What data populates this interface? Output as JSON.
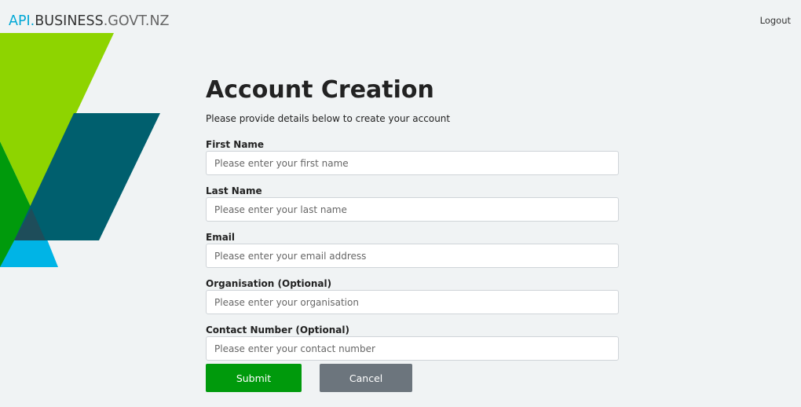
{
  "header": {
    "logo": {
      "part1": "API.",
      "part2": "BUSINESS",
      "part3": ".GOVT.NZ"
    },
    "logout_label": "Logout"
  },
  "main": {
    "title": "Account Creation",
    "subtitle": "Please provide details below to create your account",
    "fields": [
      {
        "label": "First Name",
        "placeholder": "Please enter your first name",
        "value": ""
      },
      {
        "label": "Last Name",
        "placeholder": "Please enter your last name",
        "value": ""
      },
      {
        "label": "Email",
        "placeholder": "Please enter your email address",
        "value": ""
      },
      {
        "label": "Organisation (Optional)",
        "placeholder": "Please enter your organisation",
        "value": ""
      },
      {
        "label": "Contact Number (Optional)",
        "placeholder": "Please enter your contact number",
        "value": ""
      }
    ],
    "submit_label": "Submit",
    "cancel_label": "Cancel"
  },
  "colors": {
    "background": "#f0f3f4",
    "logo_accent": "#00a8d6",
    "submit": "#009a0c",
    "cancel": "#6c757d",
    "graphic_lime": "#8ed400",
    "graphic_teal": "#005f6e",
    "graphic_green": "#009a0c",
    "graphic_cyan": "#00b4e6"
  }
}
